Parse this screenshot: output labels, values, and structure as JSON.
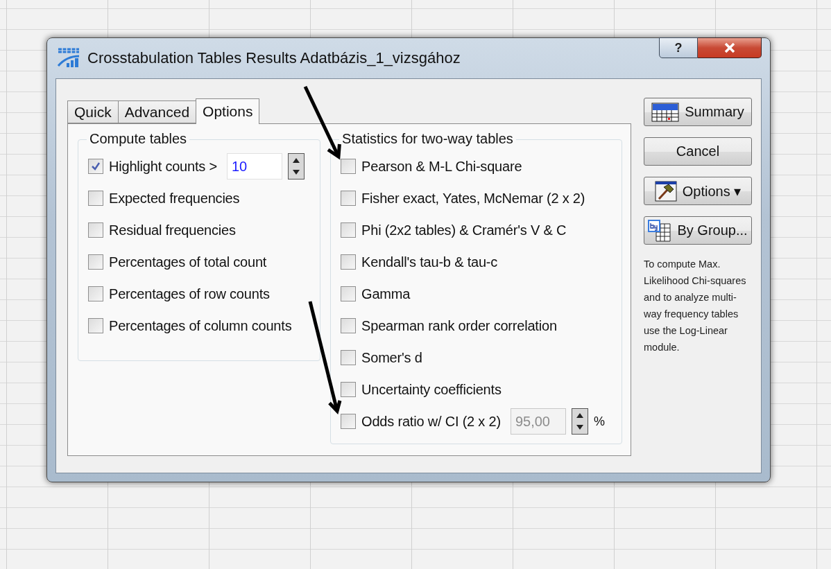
{
  "window": {
    "title": "Crosstabulation Tables Results Adatbázis_1_vizsgához",
    "help_button": "?"
  },
  "tabs": [
    {
      "label": "Quick",
      "selected": false
    },
    {
      "label": "Advanced",
      "selected": false
    },
    {
      "label": "Options",
      "selected": true
    }
  ],
  "compute_tables": {
    "title": "Compute tables",
    "items": [
      {
        "kind": "spin",
        "label": "Highlight counts >",
        "checked": true,
        "value": "10",
        "disabled": false
      },
      {
        "kind": "plain",
        "label": "Expected frequencies",
        "checked": false
      },
      {
        "kind": "plain",
        "label": "Residual frequencies",
        "checked": false
      },
      {
        "kind": "plain",
        "label": "Percentages of total count",
        "checked": false
      },
      {
        "kind": "plain",
        "label": "Percentages of row counts",
        "checked": false
      },
      {
        "kind": "plain",
        "label": "Percentages of column counts",
        "checked": false
      }
    ]
  },
  "statistics": {
    "title": "Statistics for two-way tables",
    "items": [
      {
        "kind": "plain",
        "label": "Pearson & M-L Chi-square",
        "checked": false
      },
      {
        "kind": "plain",
        "label": "Fisher exact, Yates, McNemar (2 x 2)",
        "checked": false
      },
      {
        "kind": "plain",
        "label": "Phi (2x2 tables) & Cramér's V & C",
        "checked": false
      },
      {
        "kind": "plain",
        "label": "Kendall's tau-b & tau-c",
        "checked": false
      },
      {
        "kind": "plain",
        "label": "Gamma",
        "checked": false
      },
      {
        "kind": "plain",
        "label": "Spearman rank order correlation",
        "checked": false
      },
      {
        "kind": "plain",
        "label": "Somer's d",
        "checked": false
      },
      {
        "kind": "plain",
        "label": "Uncertainty coefficients",
        "checked": false
      },
      {
        "kind": "spin",
        "label": "Odds ratio w/ CI (2 x 2)",
        "checked": false,
        "value": "95,00",
        "disabled": true,
        "suffix": "%"
      }
    ]
  },
  "buttons": [
    {
      "kind": "summary",
      "label": "Summary"
    },
    {
      "kind": "plain",
      "label": "Cancel"
    },
    {
      "kind": "dropdown",
      "label": "Options",
      "caret": "▾"
    },
    {
      "kind": "bygroup",
      "label": "By Group..."
    }
  ],
  "note": "To compute Max. Likelihood Chi-squares and to analyze multi-way frequency tables use the Log-Linear module."
}
